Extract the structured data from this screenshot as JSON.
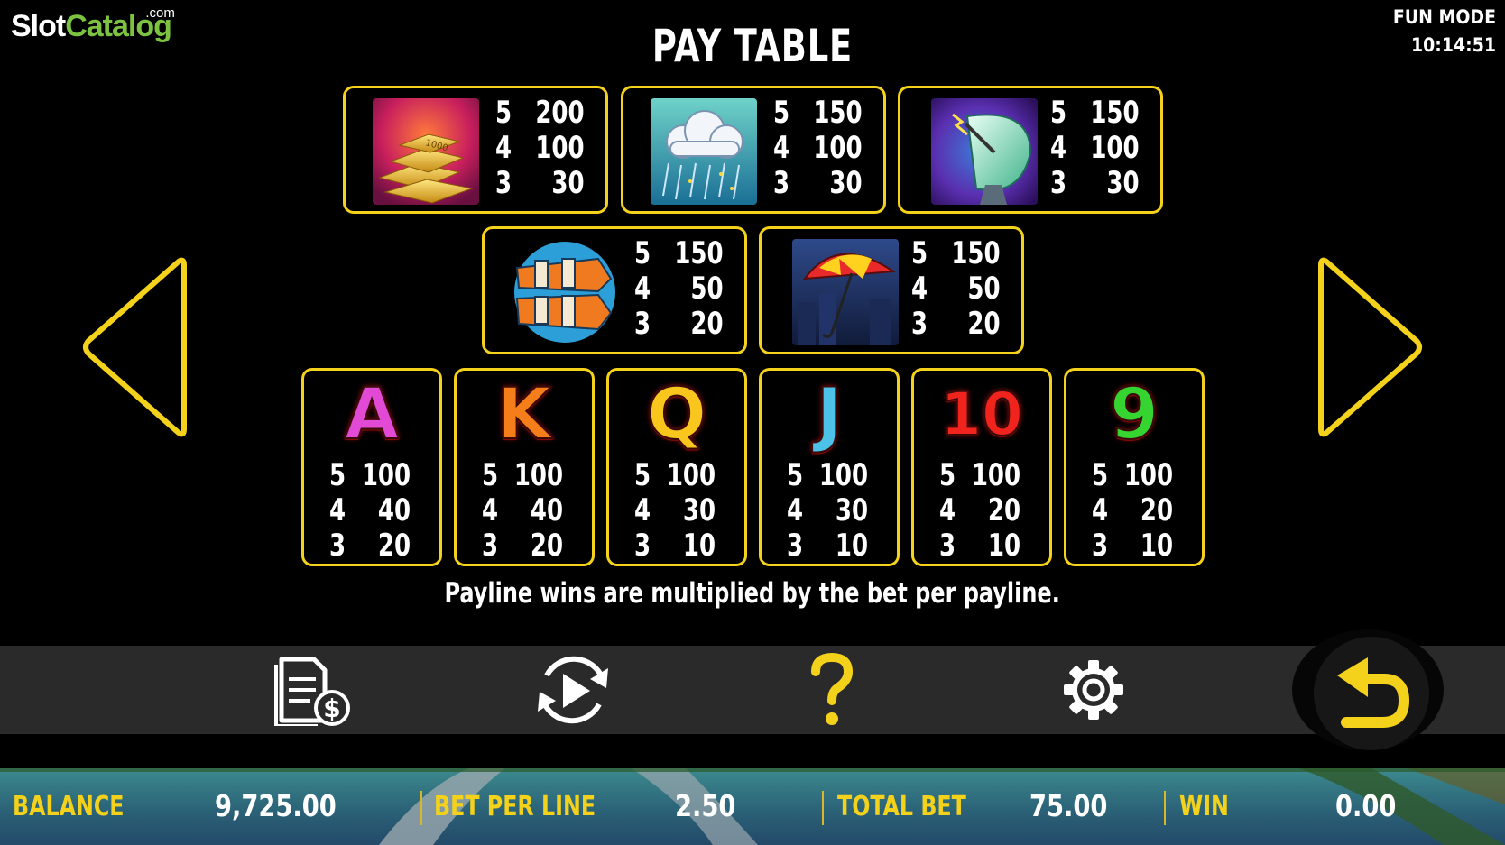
{
  "logo": {
    "part1": "Slot",
    "part2": "Catalog",
    "suffix": ".com"
  },
  "status": {
    "mode": "FUN MODE",
    "time": "10:14:51"
  },
  "title": "PAY TABLE",
  "premium_symbols": [
    {
      "icon": "gold-bars-icon",
      "rows": [
        {
          "count": "5",
          "value": "200"
        },
        {
          "count": "4",
          "value": "100"
        },
        {
          "count": "3",
          "value": "30"
        }
      ]
    },
    {
      "icon": "storm-cloud-icon",
      "rows": [
        {
          "count": "5",
          "value": "150"
        },
        {
          "count": "4",
          "value": "100"
        },
        {
          "count": "3",
          "value": "30"
        }
      ]
    },
    {
      "icon": "satellite-dish-icon",
      "rows": [
        {
          "count": "5",
          "value": "150"
        },
        {
          "count": "4",
          "value": "100"
        },
        {
          "count": "3",
          "value": "30"
        }
      ]
    },
    {
      "icon": "windsock-icon",
      "rows": [
        {
          "count": "5",
          "value": "150"
        },
        {
          "count": "4",
          "value": "50"
        },
        {
          "count": "3",
          "value": "20"
        }
      ]
    },
    {
      "icon": "umbrella-icon",
      "rows": [
        {
          "count": "5",
          "value": "150"
        },
        {
          "count": "4",
          "value": "50"
        },
        {
          "count": "3",
          "value": "20"
        }
      ]
    }
  ],
  "letter_symbols": [
    {
      "glyph": "A",
      "color": "#e24ad6",
      "rows": [
        {
          "count": "5",
          "value": "100"
        },
        {
          "count": "4",
          "value": "40"
        },
        {
          "count": "3",
          "value": "20"
        }
      ]
    },
    {
      "glyph": "K",
      "color": "#f57e1b",
      "rows": [
        {
          "count": "5",
          "value": "100"
        },
        {
          "count": "4",
          "value": "40"
        },
        {
          "count": "3",
          "value": "20"
        }
      ]
    },
    {
      "glyph": "Q",
      "color": "#f8c61c",
      "rows": [
        {
          "count": "5",
          "value": "100"
        },
        {
          "count": "4",
          "value": "30"
        },
        {
          "count": "3",
          "value": "10"
        }
      ]
    },
    {
      "glyph": "J",
      "color": "#4cc2e8",
      "rows": [
        {
          "count": "5",
          "value": "100"
        },
        {
          "count": "4",
          "value": "30"
        },
        {
          "count": "3",
          "value": "10"
        }
      ]
    },
    {
      "glyph": "10",
      "color": "#f0241d",
      "rows": [
        {
          "count": "5",
          "value": "100"
        },
        {
          "count": "4",
          "value": "20"
        },
        {
          "count": "3",
          "value": "10"
        }
      ]
    },
    {
      "glyph": "9",
      "color": "#35d431",
      "rows": [
        {
          "count": "5",
          "value": "100"
        },
        {
          "count": "4",
          "value": "20"
        },
        {
          "count": "3",
          "value": "10"
        }
      ]
    }
  ],
  "note": "Payline wins are multiplied by the bet per payline.",
  "toolbar": {
    "paytable_icon": "paytable-dollar-icon",
    "autoplay_icon": "autoplay-icon",
    "help_icon": "help-question-icon",
    "settings_icon": "gear-icon",
    "back_icon": "back-arrow-icon"
  },
  "stats": {
    "balance_label": "BALANCE",
    "balance": "9,725.00",
    "bet_label": "BET PER LINE",
    "bet": "2.50",
    "total_label": "TOTAL BET",
    "total": "75.00",
    "win_label": "WIN",
    "win": "0.00"
  },
  "colors": {
    "accent": "#f4d21c",
    "brand_green": "#7cc341"
  }
}
